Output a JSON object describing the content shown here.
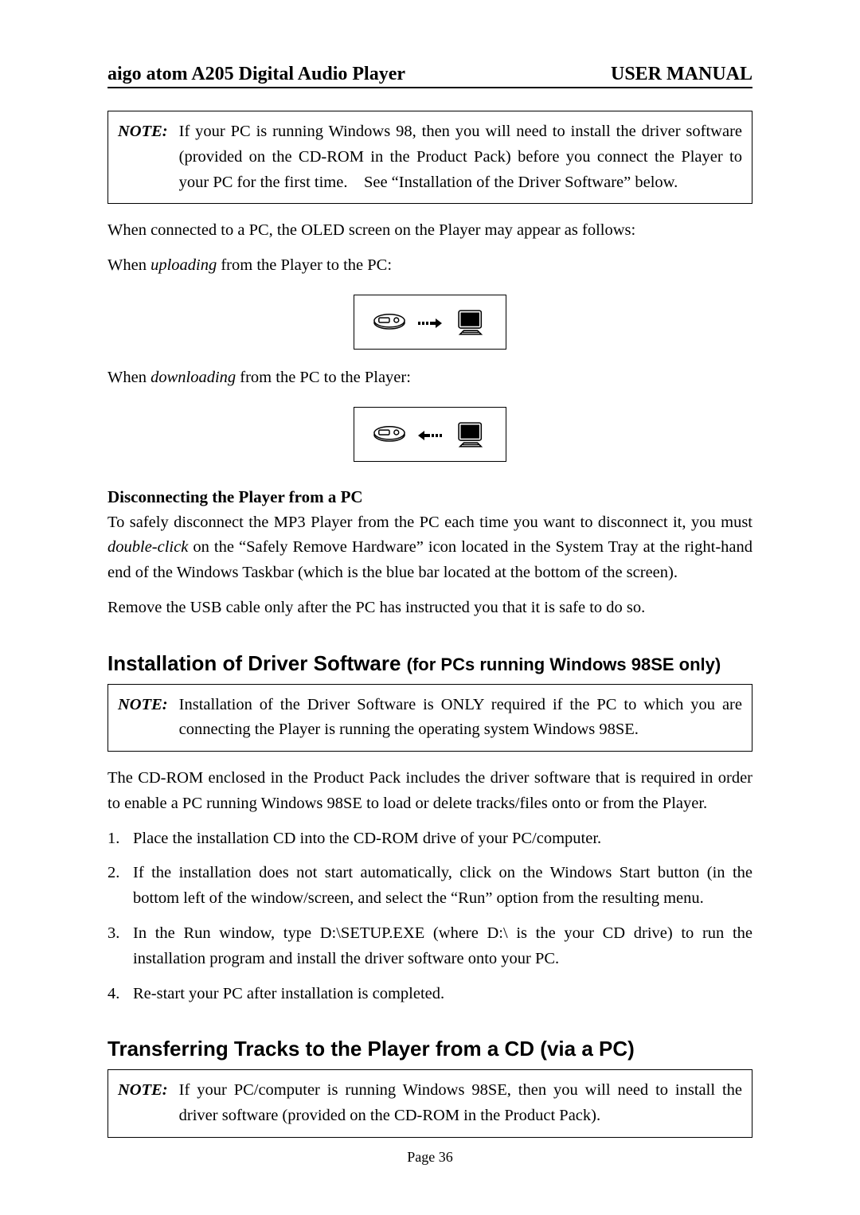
{
  "header": {
    "left": "aigo atom A205 Digital Audio Player",
    "right": "USER MANUAL"
  },
  "note1": {
    "label": "NOTE:",
    "text": "If your PC is running Windows 98, then you will need to install the driver software (provided on the CD-ROM in the Product Pack) before you connect the Player to your PC for the first time. See “Installation of the Driver Software” below."
  },
  "p_connected": "When connected to a PC, the OLED screen on the Player may appear as follows:",
  "p_uploading_pre": "When ",
  "p_uploading_em": "uploading",
  "p_uploading_post": " from the Player to the PC:",
  "p_downloading_pre": "When ",
  "p_downloading_em": "downloading",
  "p_downloading_post": " from the PC to the Player:",
  "oled_upload_arrow": "→",
  "oled_download_arrow": "←",
  "subhead_disconnect": "Disconnecting the Player from a PC",
  "p_disconnect_1a": "To safely disconnect the MP3 Player from the PC each time you want to disconnect it, you must ",
  "p_disconnect_1em": "double-click",
  "p_disconnect_1b": " on the “Safely Remove Hardware” icon located in the System Tray at the right-hand end of the Windows Taskbar (which is the blue bar located at the bottom of the screen).",
  "p_disconnect_2": "Remove the USB cable only after the PC has instructed you that it is safe to do so.",
  "section_install_main": "Installation of Driver Software ",
  "section_install_sub": "(for PCs running Windows 98SE only)",
  "note2": {
    "label": "NOTE:",
    "text": "Installation of the Driver Software is ONLY required if the PC to which you are connecting the Player is running the operating system Windows 98SE."
  },
  "p_install_intro": "The CD-ROM enclosed in the Product Pack includes the driver software that is required in order to enable a PC running Windows 98SE to load or delete tracks/files onto or from the Player.",
  "steps": [
    "Place the installation CD into the CD-ROM drive of your PC/computer.",
    "If the installation does not start automatically, click on the Windows Start button (in the bottom left of the window/screen, and select the “Run” option from the resulting menu.",
    "In the Run window, type D:\\SETUP.EXE (where D:\\ is the your CD drive) to run the installation program and install the driver software onto your PC.",
    "Re-start your PC after installation is completed."
  ],
  "section_transfer": "Transferring Tracks to the Player from a CD (via a PC)",
  "note3": {
    "label": "NOTE:",
    "text": "If your PC/computer is running Windows 98SE, then you will need to install the driver software (provided on the CD-ROM in the Product Pack)."
  },
  "page_number": "Page 36"
}
